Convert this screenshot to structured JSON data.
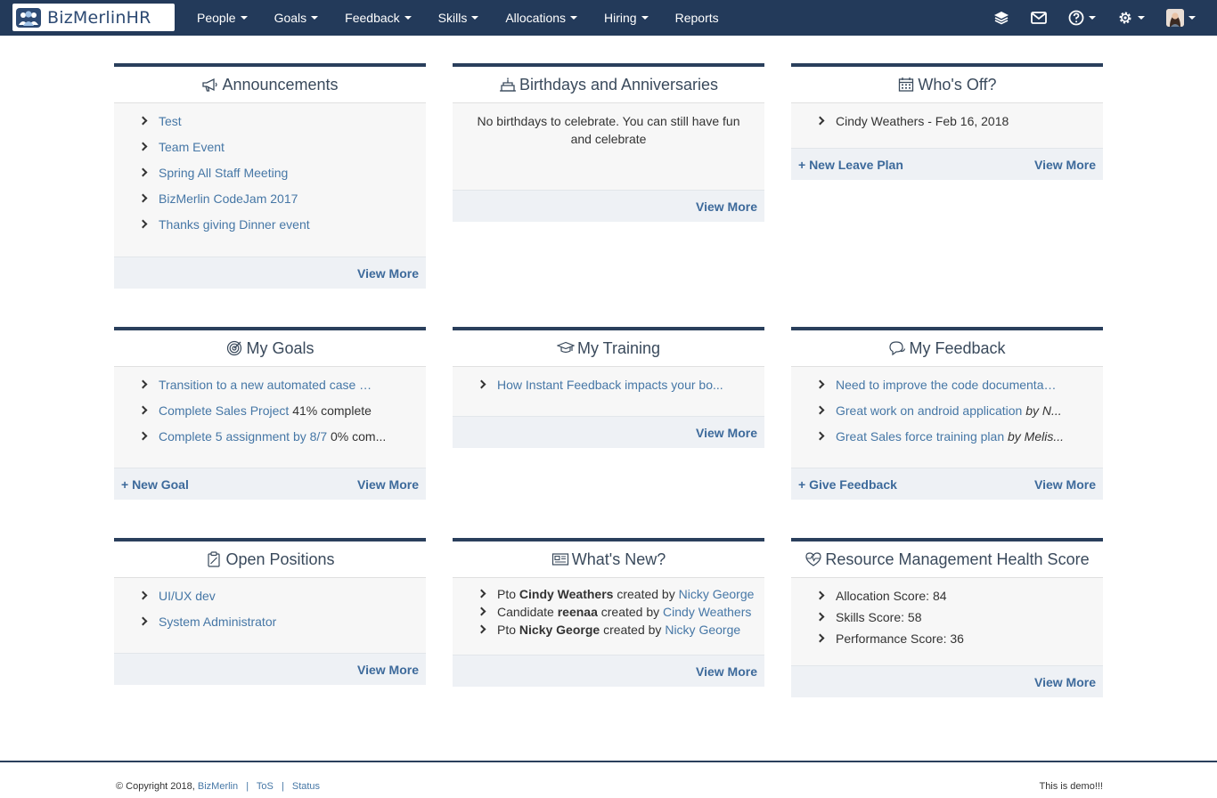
{
  "brand": {
    "name": "BizMerlinHR"
  },
  "nav": {
    "items": [
      {
        "label": "People"
      },
      {
        "label": "Goals"
      },
      {
        "label": "Feedback"
      },
      {
        "label": "Skills"
      },
      {
        "label": "Allocations"
      },
      {
        "label": "Hiring"
      },
      {
        "label": "Reports"
      }
    ],
    "right_icons": [
      "layers-icon",
      "mail-icon",
      "help-icon",
      "gear-icon",
      "avatar"
    ]
  },
  "announcements": {
    "title": "Announcements",
    "items": [
      "Test",
      "Team Event",
      "Spring All Staff Meeting",
      "BizMerlin CodeJam 2017",
      "Thanks giving Dinner event"
    ],
    "view_more": "View More"
  },
  "birthdays": {
    "title": "Birthdays and Anniversaries",
    "message": "No birthdays to celebrate. You can still have fun and celebrate",
    "view_more": "View More"
  },
  "whos_off": {
    "title": "Who's Off?",
    "items": [
      "Cindy Weathers - Feb 16, 2018"
    ],
    "new_leave": "+ New Leave Plan",
    "view_more": "View More"
  },
  "goals": {
    "title": "My Goals",
    "items": [
      {
        "link": "Transition to a new automated case ma...",
        "status": ""
      },
      {
        "link": "Complete Sales Project",
        "status": "41% complete"
      },
      {
        "link": "Complete 5 assignment by 8/7",
        "status": "0% com..."
      }
    ],
    "new_goal": "+ New Goal",
    "view_more": "View More"
  },
  "training": {
    "title": "My Training",
    "items": [
      "How Instant Feedback impacts your bo..."
    ],
    "view_more": "View More"
  },
  "feedback": {
    "title": "My Feedback",
    "items": [
      {
        "link": "Need to improve the code documentati...",
        "by": ""
      },
      {
        "link": "Great work on android application",
        "by": "by N..."
      },
      {
        "link": "Great Sales force training plan",
        "by": "by Melis..."
      }
    ],
    "give_feedback": "+ Give Feedback",
    "view_more": "View More"
  },
  "positions": {
    "title": "Open Positions",
    "items": [
      "UI/UX dev",
      "System Administrator"
    ],
    "view_more": "View More"
  },
  "whats_new": {
    "title": "What's New?",
    "items": [
      {
        "prefix": "Pto",
        "subject": "Cindy Weathers",
        "mid": "created by",
        "actor": "Nicky George"
      },
      {
        "prefix": "Candidate",
        "subject": "reenaa",
        "mid": "created by",
        "actor": "Cindy Weathers"
      },
      {
        "prefix": "Pto",
        "subject": "Nicky George",
        "mid": "created by",
        "actor": "Nicky George"
      }
    ],
    "view_more": "View More"
  },
  "health": {
    "title": "Resource Management Health Score",
    "items": [
      "Allocation Score: 84",
      "Skills Score: 58",
      "Performance Score: 36"
    ],
    "view_more": "View More"
  },
  "footer": {
    "copyright": "© Copyright 2018,",
    "company": "BizMerlin",
    "tos": "ToS",
    "status": "Status",
    "demo": "This is demo!!!"
  },
  "colors": {
    "navbar": "#233a5a",
    "link": "#4677a6",
    "panel_border": "#2a3f5c"
  }
}
